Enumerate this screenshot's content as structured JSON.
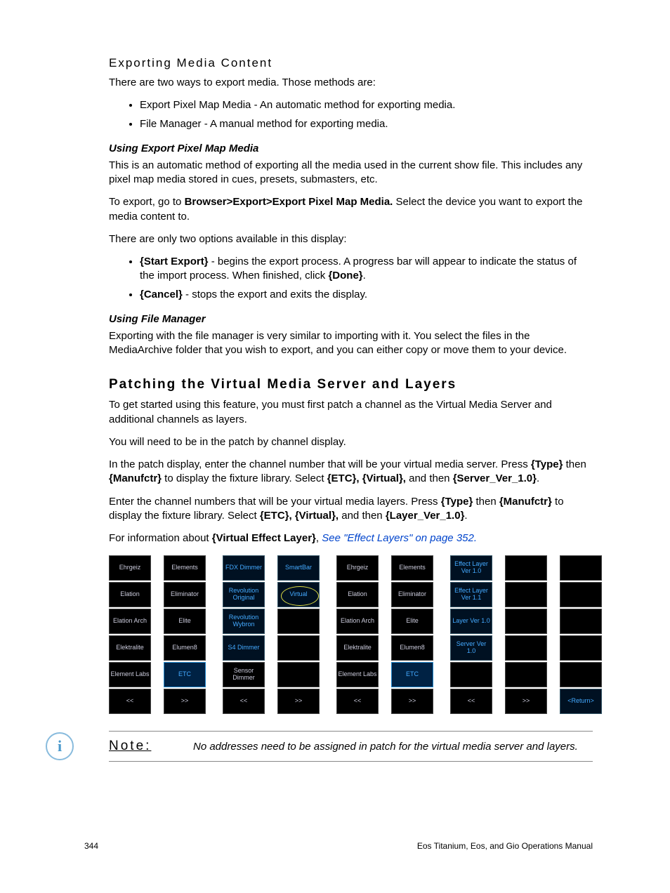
{
  "h_exporting": "Exporting Media Content",
  "p_intro": "There are two ways to export media. Those methods are:",
  "li1": "Export Pixel Map Media - An automatic method for exporting media.",
  "li2": "File Manager - A manual method for exporting media.",
  "sub_pixel": "Using Export Pixel Map Media",
  "p_pixel1": "This is an automatic method of exporting all the media used in the current show file. This includes any pixel map media stored in cues, presets, submasters, etc.",
  "p_pixel2a": "To export, go to ",
  "p_pixel2b": "Browser>Export>Export Pixel Map Media.",
  "p_pixel2c": " Select the device you want to export the media content to.",
  "p_pixel3": "There are only two options available in this display:",
  "li3a": "{Start Export}",
  "li3b": " - begins the export process. A progress bar will appear to indicate the status of the import process. When finished, click ",
  "li3c": "{Done}",
  "li3d": ".",
  "li4a": "{Cancel}",
  "li4b": " - stops the export and exits the display.",
  "sub_fm": "Using File Manager",
  "p_fm": "Exporting with the file manager is very similar to importing with it. You select the files in the MediaArchive folder that you wish to export, and you can either copy or move them to your device.",
  "h_patching": "Patching the Virtual Media Server and Layers",
  "p_patch1": "To get started using this feature, you must first patch a channel as the Virtual Media Server and additional channels as layers.",
  "p_patch2": "You will need to be in the patch by channel display.",
  "p_patch3": "In the patch display, enter the channel number that will be your virtual media server. Press {Type} then {Manufctr} to display the fixture library. Select {ETC}, {Virtual}, and then {Server_Ver_1.0}.",
  "p_patch4": "Enter the channel numbers that will be your virtual media layers. Press {Type} then {Manufctr} to display the fixture library. Select {ETC}, {Virtual}, and then {Layer_Ver_1.0}.",
  "p_patch5a": "For information about ",
  "p_patch5b": "{Virtual Effect Layer}",
  "p_patch5c": ", ",
  "p_patch5d": "See \"Effect Layers\" on page 352.",
  "note_label": "Note:",
  "note_text": "No addresses need to be assigned in patch for the virtual media server and layers.",
  "page_num": "344",
  "footer_right": "Eos Titanium, Eos, and Gio Operations Manual",
  "grid1_colA": [
    "Ehrgeiz",
    "Elation",
    "Elation Arch",
    "Elektralite",
    "Element Labs",
    "<<"
  ],
  "grid1_colB": [
    "Elements",
    "Eliminator",
    "Elite",
    "Elumen8",
    "ETC",
    ">>"
  ],
  "grid1_colC": [
    "FDX Dimmer",
    "Revolution Original",
    "Revolution Wybron",
    "S4 Dimmer",
    "Sensor Dimmer",
    "<<"
  ],
  "grid1_colD": [
    "SmartBar",
    "Virtual",
    "",
    "",
    "",
    ">>"
  ],
  "grid2_colA": [
    "Ehrgeiz",
    "Elation",
    "Elation Arch",
    "Elektralite",
    "Element Labs",
    "<<"
  ],
  "grid2_colB": [
    "Elements",
    "Eliminator",
    "Elite",
    "Elumen8",
    "ETC",
    ">>"
  ],
  "grid2_colC": [
    "Effect Layer Ver 1.0",
    "Effect Layer Ver 1.1",
    "Layer Ver 1.0",
    "Server Ver 1.0",
    "",
    "<<"
  ],
  "grid2_colD": [
    "",
    "",
    "",
    "",
    "",
    ">>"
  ],
  "grid2_colE": [
    "",
    "",
    "",
    "",
    "",
    "<Return>"
  ]
}
